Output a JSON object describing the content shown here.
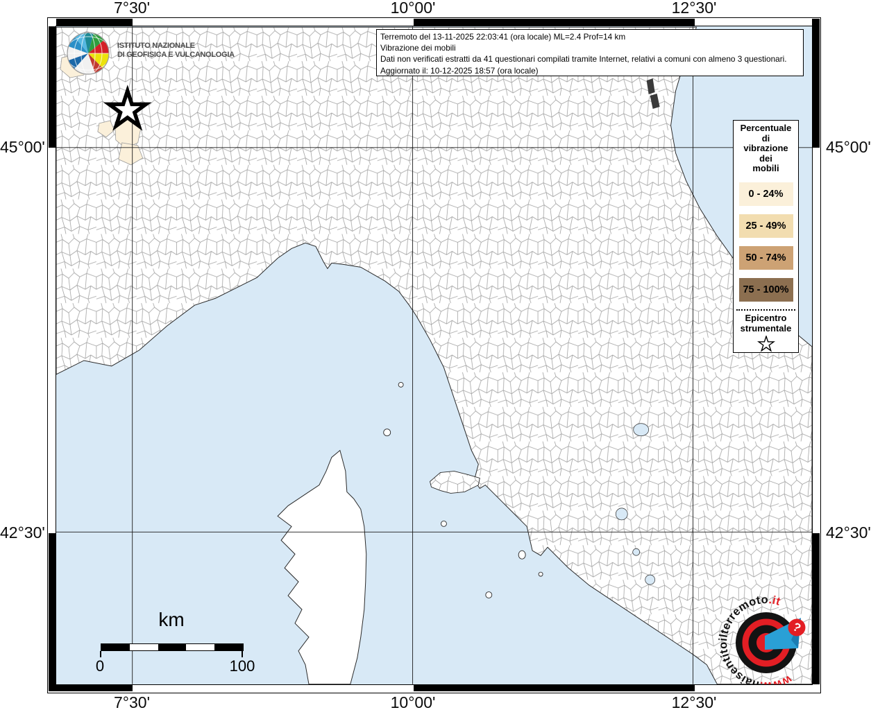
{
  "info_box": {
    "lines": [
      "Terremoto del 13-11-2025 22:03:41 (ora locale) ML=2.4 Prof=14 km",
      "Vibrazione dei mobili",
      "Dati non verificati estratti da 41 questionari compilati tramite Internet, relativi a comuni con almeno 3 questionari.",
      "Aggiornato il: 10-12-2025 18:57 (ora locale)"
    ]
  },
  "ingv": {
    "name": "ISTITUTO NAZIONALE\nDI GEOFISICA E VULCANOLOGIA"
  },
  "axes": {
    "top": [
      "7°30'",
      "10°00'",
      "12°30'"
    ],
    "bottom": [
      "7°30'",
      "10°00'",
      "12°30'"
    ],
    "left": [
      "45°00'",
      "42°30'"
    ],
    "right": [
      "45°00'",
      "42°30'"
    ]
  },
  "legend": {
    "title": "Percentuale\ndi\nvibrazione\ndei\nmobili",
    "classes": [
      {
        "label": "0 - 24%",
        "color": "#fbf0da"
      },
      {
        "label": "25 - 49%",
        "color": "#f2ddb0"
      },
      {
        "label": "50 - 74%",
        "color": "#cda274"
      },
      {
        "label": "75 - 100%",
        "color": "#8c6f50"
      }
    ],
    "epicenter_label": "Epicentro\nstrumentale"
  },
  "scalebar": {
    "unit": "km",
    "min": "0",
    "max": "100"
  },
  "watermark": {
    "prefix": "www.",
    "main": "haisentitoilterremoto",
    "tld": ".it",
    "badge": "?"
  },
  "map": {
    "sea_color": "#d8e9f6",
    "land_color": "#ffffff",
    "grid_color": "#1a1a1a",
    "brand_red": "#e31e24",
    "brand_blue": "#2aa0d6"
  }
}
